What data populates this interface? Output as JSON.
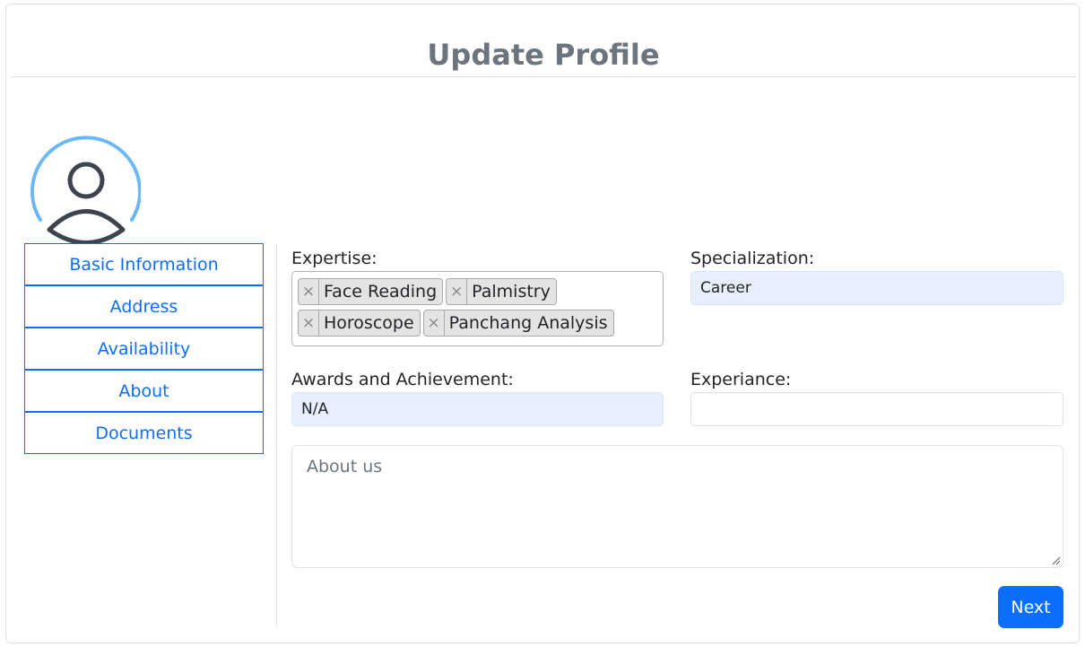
{
  "header": {
    "title": "Update Profile"
  },
  "avatar": {
    "icon": "user-avatar-icon",
    "ring_color": "#6cb8f5"
  },
  "sidebar": {
    "items": [
      {
        "label": "Basic Information"
      },
      {
        "label": "Address"
      },
      {
        "label": "Availability"
      },
      {
        "label": "About"
      },
      {
        "label": "Documents"
      }
    ]
  },
  "form": {
    "expertise": {
      "label": "Expertise:",
      "tags": [
        "Face Reading",
        "Palmistry",
        "Horoscope",
        "Panchang Analysis"
      ],
      "remove_glyph": "×"
    },
    "specialization": {
      "label": "Specialization:",
      "value": "Career"
    },
    "awards": {
      "label": "Awards and Achievement:",
      "value": "N/A"
    },
    "experience": {
      "label": "Experiance:",
      "value": ""
    },
    "about": {
      "placeholder": "About us"
    },
    "next_label": "Next"
  },
  "colors": {
    "accent": "#0d6efd",
    "autofill_bg": "#e8f0fe",
    "title": "#6c757d"
  }
}
